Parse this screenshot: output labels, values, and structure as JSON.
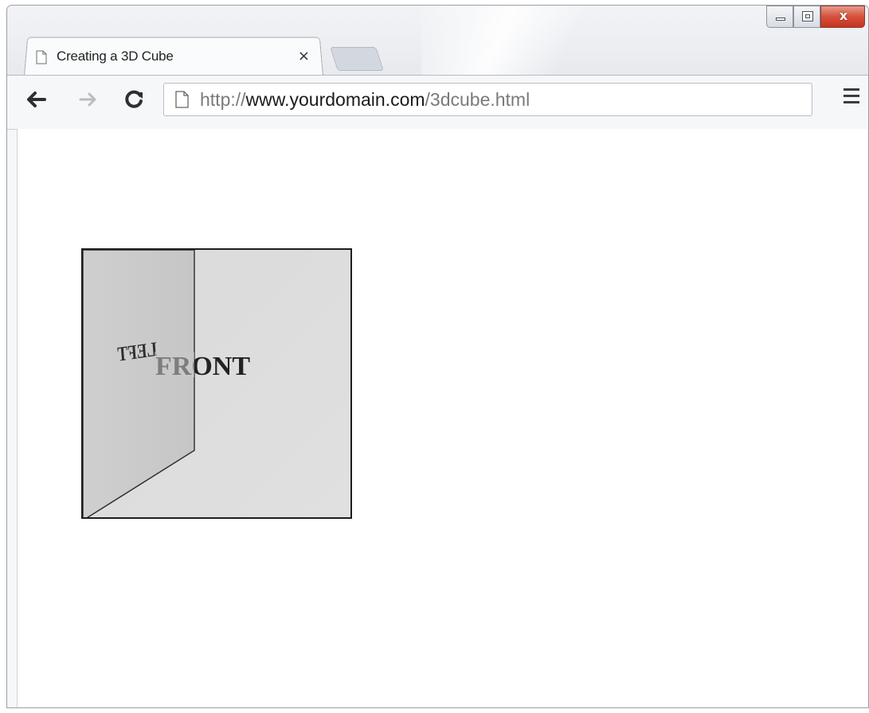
{
  "window": {
    "controls": {
      "close_glyph": "x"
    }
  },
  "tab": {
    "title": "Creating a 3D Cube",
    "close_glyph": "×",
    "icon": "page-icon"
  },
  "toolbar": {
    "back_icon": "arrow-left-icon",
    "forward_icon": "arrow-right-icon",
    "reload_icon": "reload-icon",
    "menu_icon": "hamburger-menu-icon",
    "address": {
      "scheme": "http://",
      "host": "www.yourdomain.com",
      "path": "/3dcube.html",
      "icon": "page-icon"
    }
  },
  "cube": {
    "front_label": "FRONT",
    "left_label": "LEFT"
  }
}
